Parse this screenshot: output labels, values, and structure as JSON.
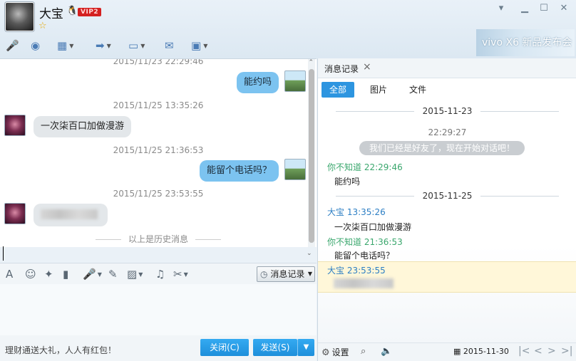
{
  "header": {
    "name": "大宝",
    "vip_badge": "VIP2",
    "ad_text": "vivo X6 新品发布会"
  },
  "toolbar": {
    "items": [
      "mic-icon",
      "video-call-icon",
      "screen-share-icon",
      "file-transfer-icon",
      "remote-desktop-icon",
      "new-chat-icon",
      "apps-icon"
    ]
  },
  "chat": {
    "top_timestamp": "2015/11/23 22:29:46",
    "messages": [
      {
        "from": "me",
        "text": "能约吗"
      },
      {
        "timestamp": "2015/11/25 13:35:26",
        "from": "other",
        "text": "一次柒百口加做漫游"
      },
      {
        "timestamp": "2015/11/25 21:36:53",
        "from": "me",
        "text": "能留个电话吗？"
      },
      {
        "timestamp": "2015/11/25 23:53:55",
        "from": "other",
        "text": ""
      }
    ],
    "history_divider": "以上是历史消息"
  },
  "input_toolbar": {
    "history_button": "消息记录"
  },
  "footer": {
    "promo": "理财通送大礼，人人有红包！",
    "close_button": "关闭(C)",
    "send_button": "发送(S)"
  },
  "history_panel": {
    "tab_label": "消息记录",
    "filters": [
      "全部",
      "图片",
      "文件"
    ],
    "date1": "2015-11-23",
    "sys_time": "22:29:27",
    "sys_message": "我们已经是好友了，现在开始对话吧！",
    "entries": [
      {
        "sender": "你不知道",
        "time": "22:29:46",
        "text": "能约吗"
      },
      {
        "sender": "大宝",
        "time": "13:35:26",
        "text": "一次柒百口加做漫游"
      },
      {
        "sender": "你不知道",
        "time": "21:36:53",
        "text": "能留个电话吗？"
      },
      {
        "sender": "大宝",
        "time": "23:53:55",
        "text": ""
      }
    ],
    "date2": "2015-11-25",
    "settings_label": "设置",
    "footer_date": "2015-11-30"
  },
  "colors": {
    "accent_blue": "#2d95e0",
    "my_bubble": "#7cc3f0",
    "other_bubble": "#e3e7ea",
    "sender_green": "#3aa76d",
    "sender_blue": "#2d7fc4"
  }
}
